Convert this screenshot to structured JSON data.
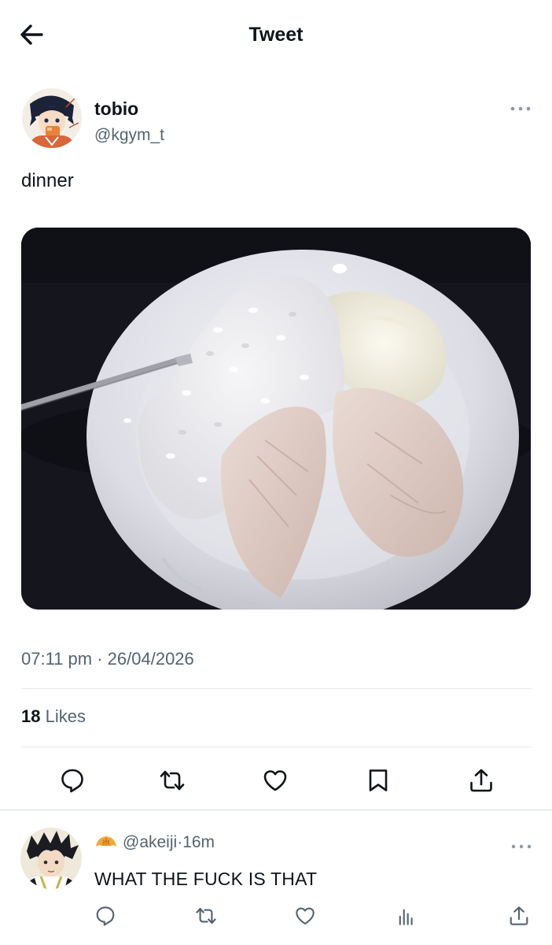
{
  "header": {
    "title": "Tweet"
  },
  "tweet": {
    "name": "tobio",
    "handle": "@kgym_t",
    "text": "dinner",
    "time": "07:11 pm",
    "separator": " · ",
    "date": "26/04/2026",
    "likes_count": "18",
    "likes_label": "Likes"
  },
  "reply": {
    "handle": "@akeiji",
    "separator": " · ",
    "age": "16m",
    "text": "WHAT THE FUCK IS THAT"
  },
  "colors": {
    "text": "#0f1419",
    "secondary": "#536471",
    "divider": "#e6e9ec"
  },
  "icons": [
    "back-arrow-icon",
    "more-dots-icon",
    "reply-icon",
    "retweet-icon",
    "like-icon",
    "bookmark-icon",
    "share-icon",
    "analytics-icon",
    "croissant-icon"
  ]
}
